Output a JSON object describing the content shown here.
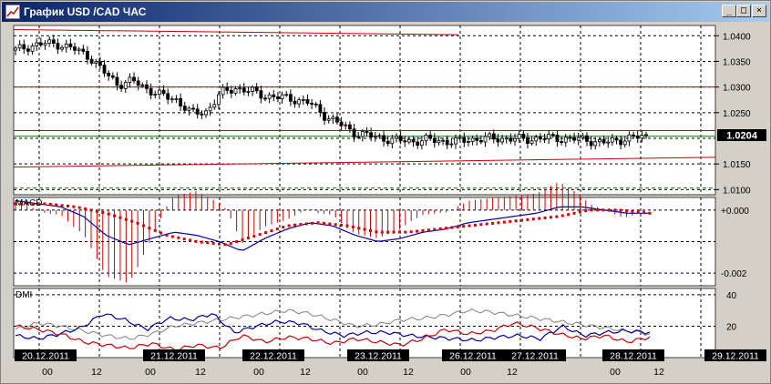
{
  "window": {
    "title": "График USD /CAD  ЧАС",
    "minimize_glyph": "_",
    "maximize_glyph": "□",
    "close_glyph": "×"
  },
  "price_panel": {
    "y_labels": [
      "1.0400",
      "1.0350",
      "1.0300",
      "1.0250",
      "1.0150",
      "1.0100"
    ],
    "current_price": "1.0204",
    "ylim": [
      1.009,
      1.042
    ],
    "colors": {
      "grid": "#000000",
      "resistance": "#cc0000",
      "support": "#008000",
      "current_bg": "#000000"
    }
  },
  "macd_panel": {
    "title": "MACD",
    "y_labels": [
      "+0.000",
      "-0.002"
    ],
    "colors": {
      "histogram": "#cc0000",
      "signal": "#dd0000",
      "macd": "#0000aa"
    }
  },
  "dmi_panel": {
    "title": "DMI",
    "y_labels": [
      "40",
      "20"
    ],
    "colors": {
      "adx": "#808080",
      "plus_di": "#0000aa",
      "minus_di": "#cc0000"
    }
  },
  "time_axis": {
    "date_labels": [
      "20.12.2011",
      "21.12.2011",
      "22.12.2011",
      "23.12.2011",
      "26.12.2011",
      "27.12.2011",
      "28.12.2011",
      "29.12.2011"
    ],
    "hour_labels": [
      "00",
      "12",
      "00",
      "12",
      "00",
      "12",
      "00",
      "12",
      "00",
      "12",
      "00",
      "12"
    ]
  },
  "chart_data": {
    "type": "line",
    "series": [
      {
        "values": [
          1.0372,
          1.038,
          1.0385,
          1.0383,
          1.0374,
          1.036,
          1.033,
          1.0305,
          1.0312,
          1.0296,
          1.0283,
          1.0275,
          1.0248,
          1.0252,
          1.0288,
          1.0298,
          1.0292,
          1.0283,
          1.028,
          1.0276,
          1.027,
          1.0246,
          1.023,
          1.0212,
          1.0206,
          1.02,
          1.0196,
          1.0194,
          1.0197,
          1.0195,
          1.0193,
          1.0198,
          1.0199,
          1.02,
          1.0199,
          1.0198,
          1.0201,
          1.02,
          1.0199,
          1.0197,
          1.0191,
          1.0196,
          1.0201,
          1.0204
        ]
      },
      {
        "values": [
          0.0003,
          0.0002,
          0.0001,
          -0.0002,
          -0.0008,
          -0.0011,
          -0.0009,
          -0.0007,
          -0.0008,
          -0.001,
          -0.0013,
          -0.0009,
          -0.0006,
          -0.0004,
          -0.0005,
          -0.0008,
          -0.001,
          -0.0009,
          -0.0007,
          -0.0006,
          -0.0004,
          -0.0003,
          -0.0002,
          -0.0001,
          0.0001,
          0.0001,
          0.0,
          -0.0001,
          -0.0001
        ]
      },
      {
        "values": [
          0.0002,
          0.0002,
          0.0001,
          -0.0001,
          -0.0004,
          -0.0008,
          -0.001,
          -0.0011,
          -0.0008,
          -0.0005,
          -0.0004,
          -0.0005,
          -0.0007,
          -0.0007,
          -0.0006,
          -0.0005,
          -0.0004,
          -0.0003,
          -0.0002,
          0.0,
          0.0,
          -0.0001
        ]
      },
      {
        "values": [
          18,
          22,
          20,
          17,
          14,
          12,
          15,
          20,
          22,
          24,
          26,
          28,
          30,
          28,
          24,
          20,
          21,
          24,
          25,
          27,
          30,
          29,
          27,
          25,
          23,
          21,
          19,
          17,
          15
        ]
      },
      {
        "values": [
          14,
          12,
          15,
          19,
          28,
          24,
          18,
          25,
          24,
          28,
          16,
          20,
          23,
          22,
          17,
          14,
          16,
          16,
          14,
          13,
          12,
          11,
          13,
          14,
          12,
          20,
          14,
          16,
          17,
          16
        ]
      },
      {
        "values": [
          20,
          18,
          15,
          10,
          8,
          6,
          9,
          5,
          8,
          6,
          14,
          10,
          13,
          12,
          9,
          12,
          10,
          8,
          12,
          18,
          15,
          17,
          22,
          19,
          15,
          12,
          14,
          10,
          13
        ]
      }
    ]
  }
}
